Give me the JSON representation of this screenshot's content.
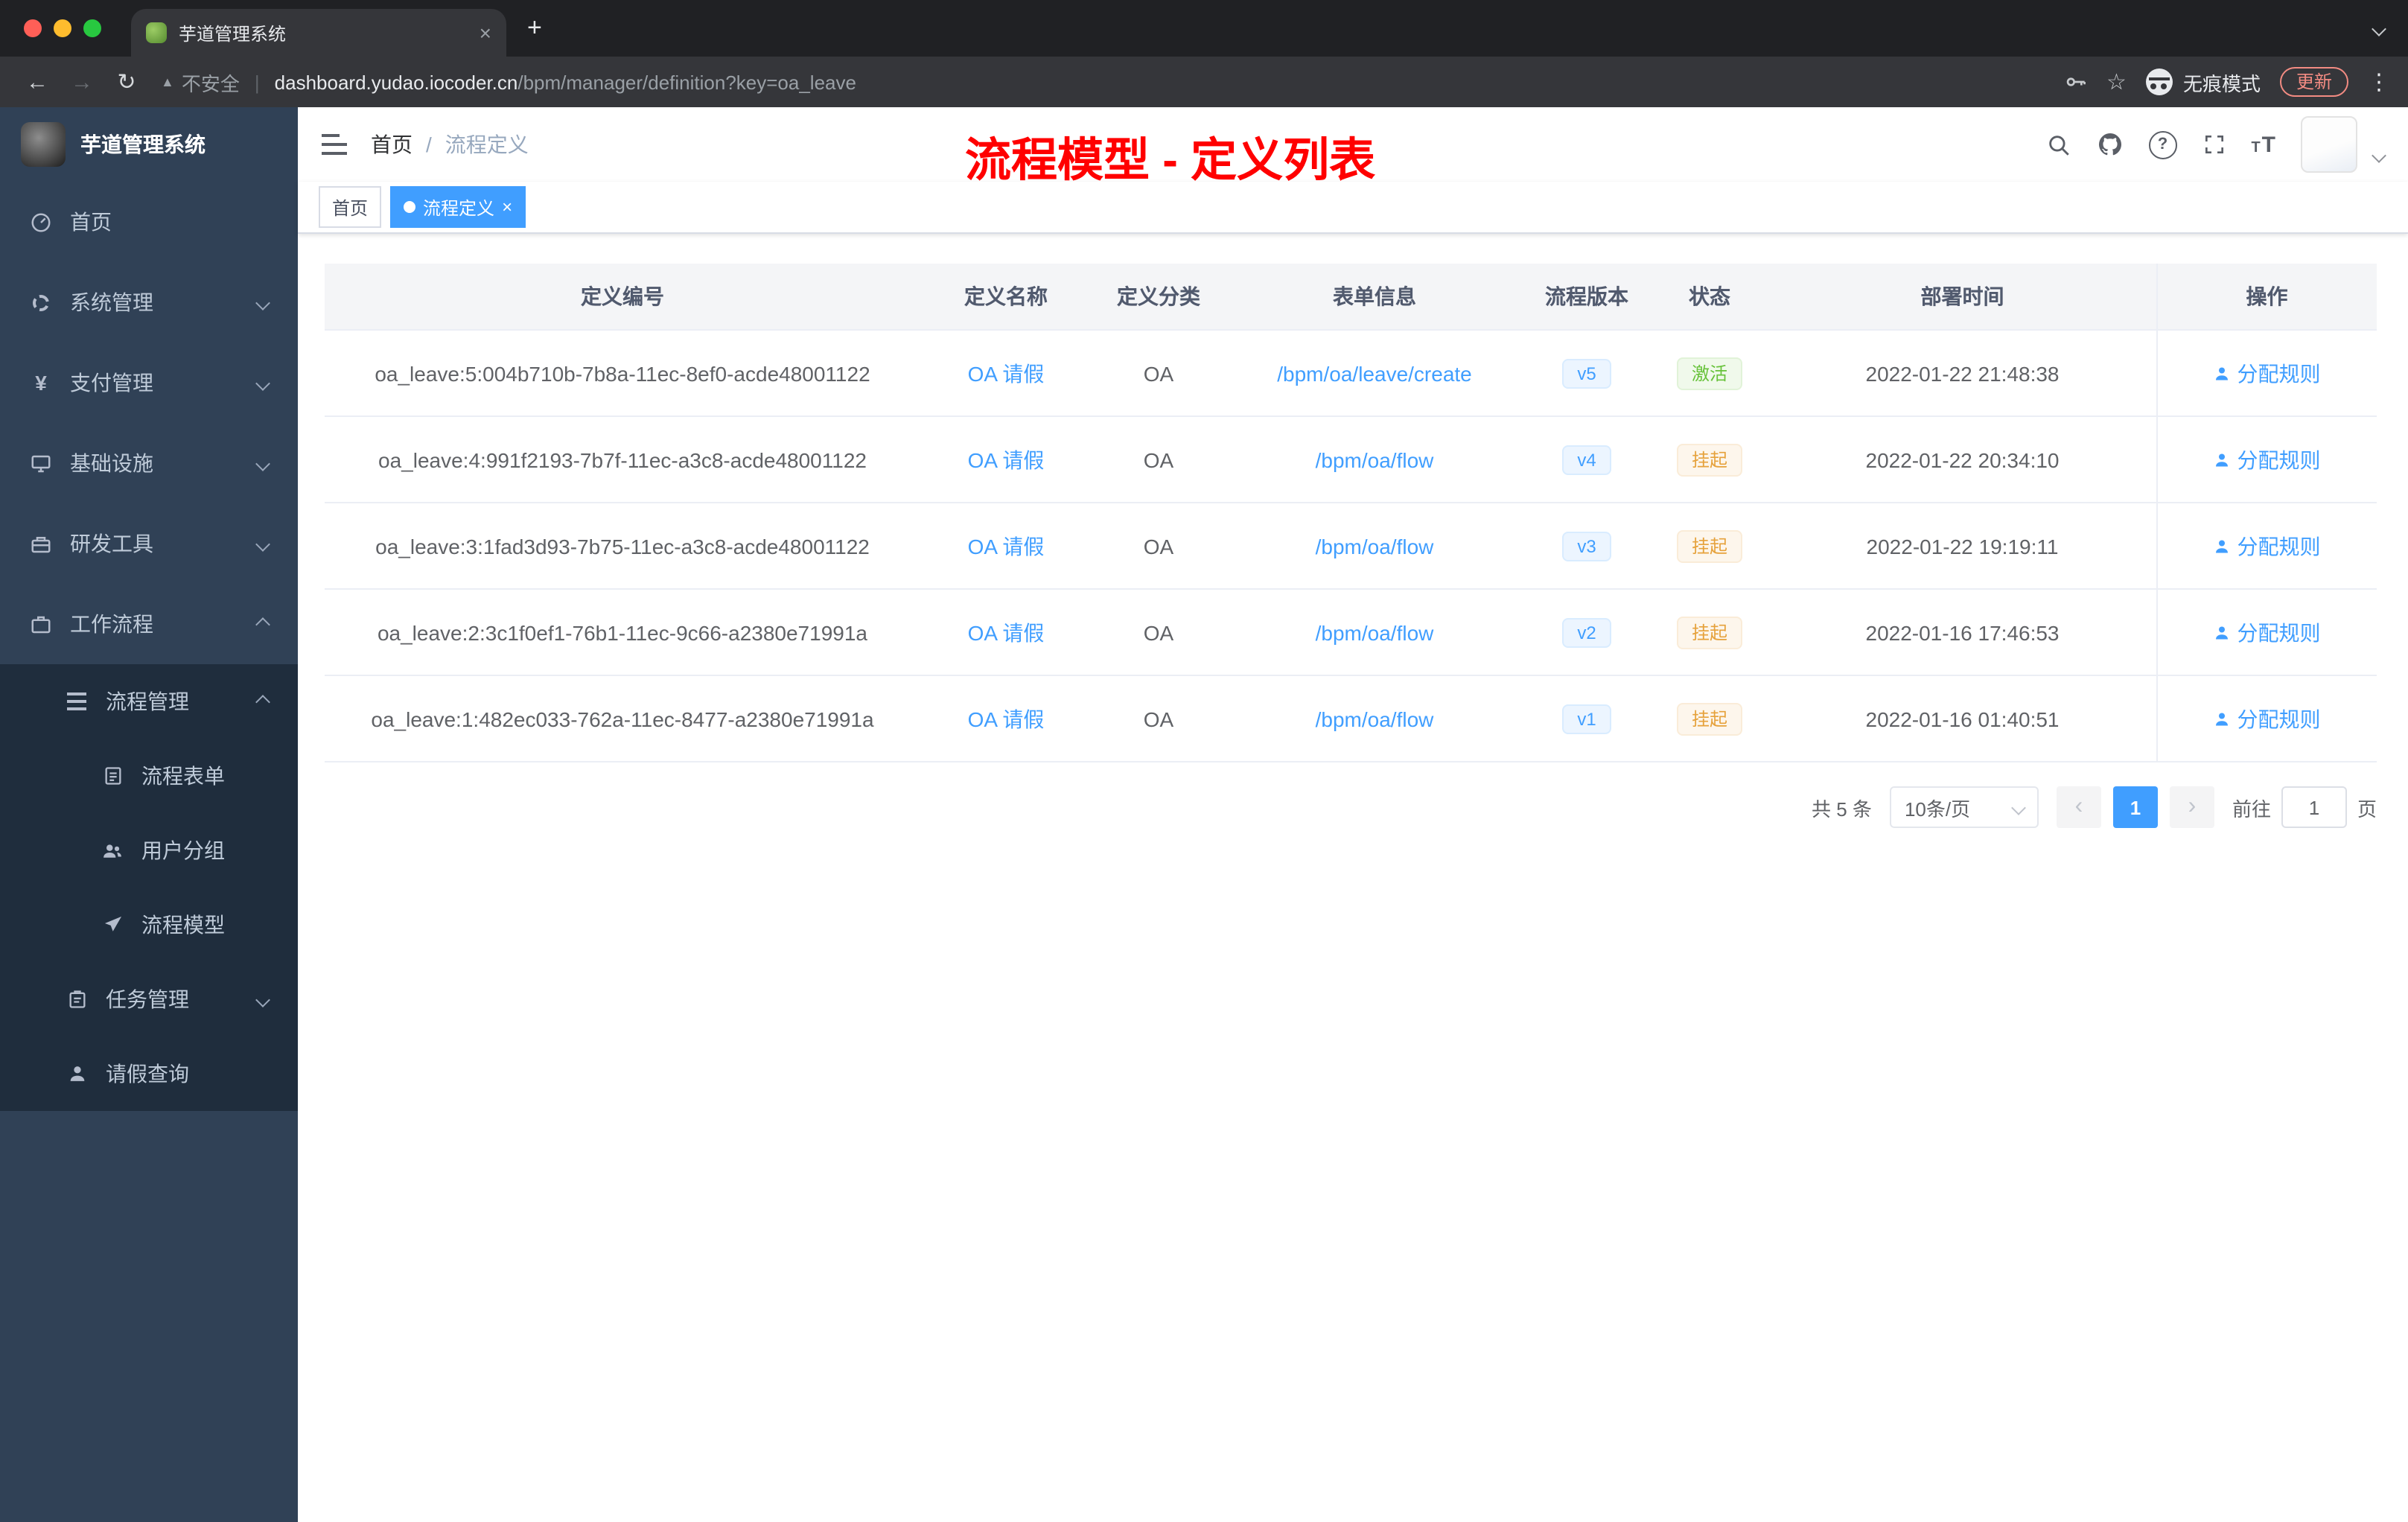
{
  "colors": {
    "accent": "#409EFF",
    "success": "#67C23A",
    "warning": "#E6A23C",
    "annotation_red": "#FF0000",
    "sidebar_bg": "#304156",
    "submenu_bg": "#1F2D3D"
  },
  "icons": {
    "close": "×",
    "plus": "+",
    "back": "←",
    "forward": "→",
    "reload": "↻",
    "warning_triangle": "▲",
    "divider": "|",
    "star": "☆",
    "overflow_dots": "⋮",
    "question_mark": "?",
    "yuan": "¥",
    "breadcrumb_separator": "/",
    "prev_arrow": "‹",
    "next_arrow": "›",
    "font_small": "T",
    "font_large": "T"
  },
  "browser": {
    "tab_title": "芋道管理系统",
    "security_label": "不安全",
    "url_host": "dashboard.yudao.iocoder.cn",
    "url_path": "/bpm/manager/definition?key=oa_leave",
    "incognito_label": "无痕模式",
    "update_label": "更新"
  },
  "sidebar": {
    "logo_title": "芋道管理系统",
    "home": "首页",
    "system": "系统管理",
    "payment": "支付管理",
    "infra": "基础设施",
    "devtools": "研发工具",
    "workflow": "工作流程",
    "process_mgmt": "流程管理",
    "process_form": "流程表单",
    "user_group": "用户分组",
    "process_model": "流程模型",
    "task_mgmt": "任务管理",
    "leave_query": "请假查询"
  },
  "navbar": {
    "breadcrumb_home": "首页",
    "breadcrumb_current": "流程定义",
    "annotation": "流程模型 - 定义列表"
  },
  "tags": {
    "home": "首页",
    "active": "流程定义"
  },
  "table": {
    "columns": [
      "定义编号",
      "定义名称",
      "定义分类",
      "表单信息",
      "流程版本",
      "状态",
      "部署时间",
      "操作"
    ],
    "rows": [
      {
        "id": "oa_leave:5:004b710b-7b8a-11ec-8ef0-acde48001122",
        "name": "OA 请假",
        "category": "OA",
        "form": "/bpm/oa/leave/create",
        "version": "v5",
        "status": "激活",
        "time": "2022-01-22 21:48:38",
        "action": "分配规则"
      },
      {
        "id": "oa_leave:4:991f2193-7b7f-11ec-a3c8-acde48001122",
        "name": "OA 请假",
        "category": "OA",
        "form": "/bpm/oa/flow",
        "version": "v4",
        "status": "挂起",
        "time": "2022-01-22 20:34:10",
        "action": "分配规则"
      },
      {
        "id": "oa_leave:3:1fad3d93-7b75-11ec-a3c8-acde48001122",
        "name": "OA 请假",
        "category": "OA",
        "form": "/bpm/oa/flow",
        "version": "v3",
        "status": "挂起",
        "time": "2022-01-22 19:19:11",
        "action": "分配规则"
      },
      {
        "id": "oa_leave:2:3c1f0ef1-76b1-11ec-9c66-a2380e71991a",
        "name": "OA 请假",
        "category": "OA",
        "form": "/bpm/oa/flow",
        "version": "v2",
        "status": "挂起",
        "time": "2022-01-16 17:46:53",
        "action": "分配规则"
      },
      {
        "id": "oa_leave:1:482ec033-762a-11ec-8477-a2380e71991a",
        "name": "OA 请假",
        "category": "OA",
        "form": "/bpm/oa/flow",
        "version": "v1",
        "status": "挂起",
        "time": "2022-01-16 01:40:51",
        "action": "分配规则"
      }
    ]
  },
  "pagination": {
    "total": "共 5 条",
    "page_size": "10条/页",
    "current_page": "1",
    "goto_label": "前往",
    "goto_value": "1",
    "page_unit": "页"
  }
}
